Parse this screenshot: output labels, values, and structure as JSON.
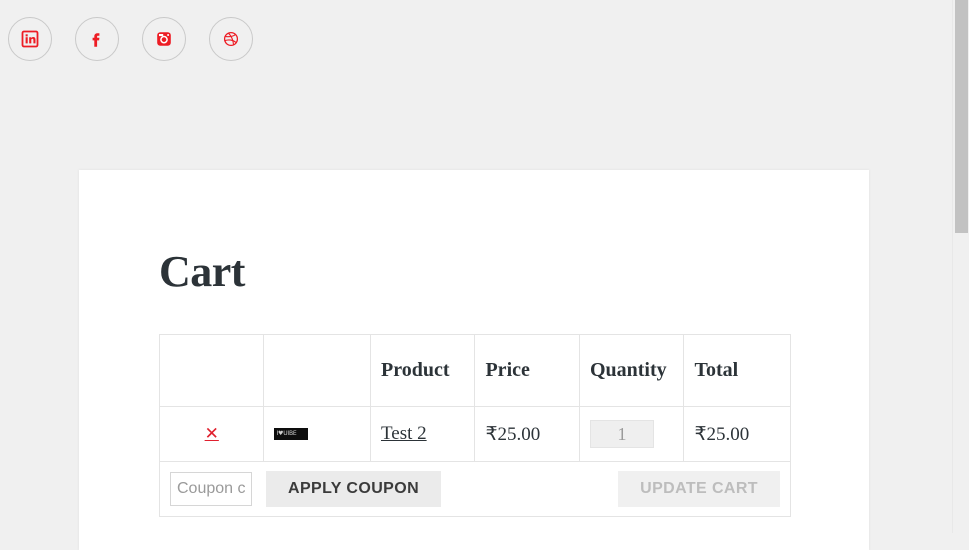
{
  "social": {
    "items": [
      {
        "name": "linkedin",
        "label": "LinkedIn",
        "icon": "linkedin-icon"
      },
      {
        "name": "facebook",
        "label": "Facebook",
        "icon": "facebook-icon"
      },
      {
        "name": "instagram",
        "label": "Instagram",
        "icon": "instagram-icon"
      },
      {
        "name": "dribbble",
        "label": "Dribbble",
        "icon": "dribbble-icon"
      }
    ],
    "icon_color": "#ed1c24",
    "ring_color": "#c9c9c9"
  },
  "page": {
    "title": "Cart",
    "background": "#f0f0f0",
    "card_background": "#ffffff"
  },
  "cart": {
    "headers": [
      "",
      "",
      "Product",
      "Price",
      "Quantity",
      "Total"
    ],
    "rows": [
      {
        "remove": "✕",
        "thumbnail_alt": "I♥UIBE",
        "product": "Test 2",
        "price": "₹25.00",
        "quantity": "1",
        "total": "₹25.00"
      }
    ],
    "remove_color": "#e0202e"
  },
  "actions": {
    "coupon_placeholder": "Coupon code",
    "coupon_value": "",
    "apply_label": "APPLY COUPON",
    "update_label": "UPDATE CART"
  },
  "scrollbar": {
    "thumb_color": "#c2c2c2",
    "track_color": "#f0f0f0"
  }
}
